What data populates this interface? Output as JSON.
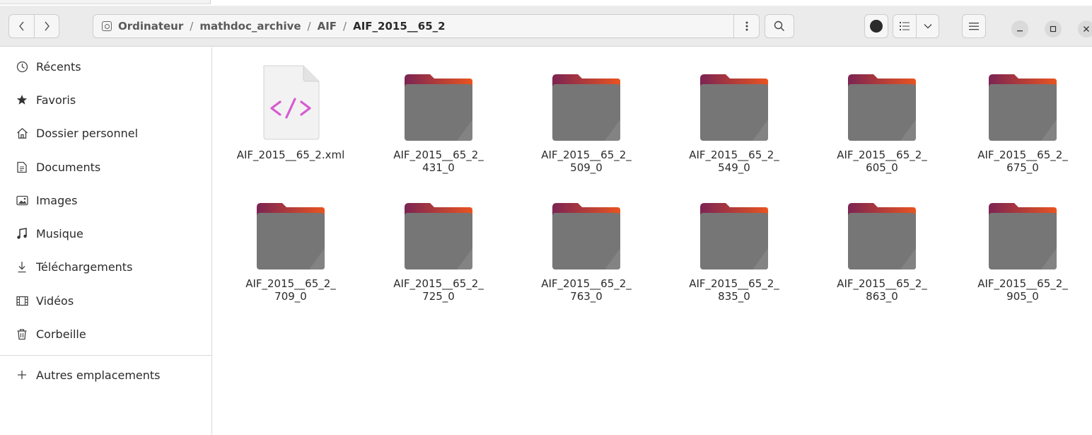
{
  "header": {
    "path": {
      "crumbs": [
        {
          "label": "Ordinateur"
        },
        {
          "label": "mathdoc_archive"
        },
        {
          "label": "AIF"
        },
        {
          "label": "AIF_2015__65_2"
        }
      ],
      "separator": "/"
    },
    "icons": {
      "back": "chevron-left-icon",
      "forward": "chevron-right-icon",
      "location_menu": "vertical-dots-icon",
      "search": "search-icon",
      "record": "record-icon",
      "list_view": "list-view-icon",
      "view_options": "chevron-down-icon",
      "main_menu": "hamburger-icon",
      "minimize": "minimize-icon",
      "maximize": "maximize-icon",
      "close": "close-icon"
    }
  },
  "sidebar": {
    "items": [
      {
        "label": "Récents",
        "icon": "clock-icon"
      },
      {
        "label": "Favoris",
        "icon": "star-icon"
      },
      {
        "label": "Dossier personnel",
        "icon": "home-icon"
      },
      {
        "label": "Documents",
        "icon": "document-icon"
      },
      {
        "label": "Images",
        "icon": "image-icon"
      },
      {
        "label": "Musique",
        "icon": "music-icon"
      },
      {
        "label": "Téléchargements",
        "icon": "download-icon"
      },
      {
        "label": "Vidéos",
        "icon": "film-icon"
      },
      {
        "label": "Corbeille",
        "icon": "trash-icon"
      }
    ],
    "other_locations": {
      "label": "Autres emplacements",
      "icon": "plus-icon"
    }
  },
  "files": [
    {
      "name": "AIF_2015__65_2.xml",
      "type": "xml-file"
    },
    {
      "name": "AIF_2015__65_2_\n431_0",
      "type": "folder"
    },
    {
      "name": "AIF_2015__65_2_\n509_0",
      "type": "folder"
    },
    {
      "name": "AIF_2015__65_2_\n549_0",
      "type": "folder"
    },
    {
      "name": "AIF_2015__65_2_\n605_0",
      "type": "folder"
    },
    {
      "name": "AIF_2015__65_2_\n675_0",
      "type": "folder"
    },
    {
      "name": "AIF_2015__65_2_\n709_0",
      "type": "folder"
    },
    {
      "name": "AIF_2015__65_2_\n725_0",
      "type": "folder"
    },
    {
      "name": "AIF_2015__65_2_\n763_0",
      "type": "folder"
    },
    {
      "name": "AIF_2015__65_2_\n835_0",
      "type": "folder"
    },
    {
      "name": "AIF_2015__65_2_\n863_0",
      "type": "folder"
    },
    {
      "name": "AIF_2015__65_2_\n905_0",
      "type": "folder"
    }
  ],
  "colors": {
    "folder_body": "#767676",
    "folder_tab_start": "#7b2453",
    "folder_tab_end": "#e95420",
    "xml_glyph": "#d75ad0"
  }
}
